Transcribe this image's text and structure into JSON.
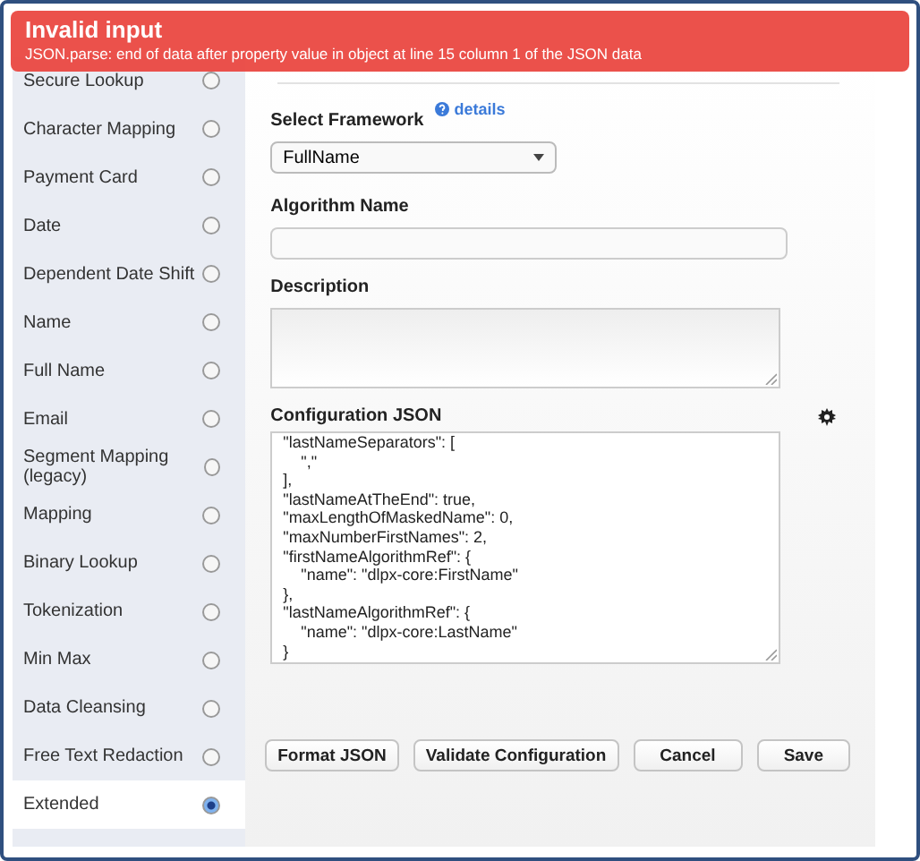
{
  "alert": {
    "title": "Invalid input",
    "message": "JSON.parse: end of data after property value in object at line 15 column 1 of the JSON data"
  },
  "sidebar": {
    "items": [
      {
        "label": "Secure Lookup",
        "selected": false
      },
      {
        "label": "Character Mapping",
        "selected": false
      },
      {
        "label": "Payment Card",
        "selected": false
      },
      {
        "label": "Date",
        "selected": false
      },
      {
        "label": "Dependent Date Shift",
        "selected": false
      },
      {
        "label": "Name",
        "selected": false
      },
      {
        "label": "Full Name",
        "selected": false
      },
      {
        "label": "Email",
        "selected": false
      },
      {
        "label": "Segment Mapping (legacy)",
        "selected": false
      },
      {
        "label": "Mapping",
        "selected": false
      },
      {
        "label": "Binary Lookup",
        "selected": false
      },
      {
        "label": "Tokenization",
        "selected": false
      },
      {
        "label": "Min Max",
        "selected": false
      },
      {
        "label": "Data Cleansing",
        "selected": false
      },
      {
        "label": "Free Text Redaction",
        "selected": false
      },
      {
        "label": "Extended",
        "selected": true
      }
    ]
  },
  "form": {
    "framework_label": "Select Framework",
    "details_link": "details",
    "framework_value": "FullName",
    "name_label": "Algorithm Name",
    "description_label": "Description",
    "config_label": "Configuration JSON",
    "config_lines": [
      "\"lastNameSeparators\": [",
      "    \",\"",
      "],",
      "\"lastNameAtTheEnd\": true,",
      "\"maxLengthOfMaskedName\": 0,",
      "\"maxNumberFirstNames\": 2,",
      "\"firstNameAlgorithmRef\": {",
      "    \"name\": \"dlpx-core:FirstName\"",
      "},",
      "\"lastNameAlgorithmRef\": {",
      "    \"name\": \"dlpx-core:LastName\"",
      "}"
    ]
  },
  "buttons": [
    "Format JSON",
    "Validate Configuration",
    "Cancel",
    "Save"
  ]
}
